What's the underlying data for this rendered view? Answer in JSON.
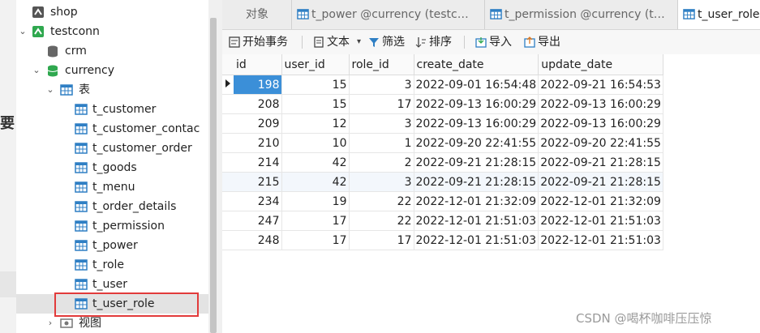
{
  "side_fragment": {
    "glyph": "要"
  },
  "tree": {
    "shop": "shop",
    "testconn": "testconn",
    "crm": "crm",
    "currency": "currency",
    "tables_folder": "表",
    "tables": [
      "t_customer",
      "t_customer_contac",
      "t_customer_order",
      "t_goods",
      "t_menu",
      "t_order_details",
      "t_permission",
      "t_power",
      "t_role",
      "t_user",
      "t_user_role"
    ],
    "views_folder": "视图"
  },
  "tabs": [
    {
      "label": "对象"
    },
    {
      "label": "t_power @currency (testc…"
    },
    {
      "label": "t_permission @currency (t…"
    },
    {
      "label": "t_user_role"
    }
  ],
  "toolbar": {
    "begin_tx": "开始事务",
    "text": "文本",
    "text_caret": "▾",
    "filter": "筛选",
    "sort": "排序",
    "import": "导入",
    "export": "导出"
  },
  "grid": {
    "columns": [
      "id",
      "user_id",
      "role_id",
      "create_date",
      "update_date"
    ],
    "rows": [
      [
        "198",
        "15",
        "3",
        "2022-09-01 16:54:48",
        "2022-09-21 16:54:53"
      ],
      [
        "208",
        "15",
        "17",
        "2022-09-13 16:00:29",
        "2022-09-13 16:00:29"
      ],
      [
        "209",
        "12",
        "3",
        "2022-09-13 16:00:29",
        "2022-09-13 16:00:29"
      ],
      [
        "210",
        "10",
        "1",
        "2022-09-20 22:41:55",
        "2022-09-20 22:41:55"
      ],
      [
        "214",
        "42",
        "2",
        "2022-09-21 21:28:15",
        "2022-09-21 21:28:15"
      ],
      [
        "215",
        "42",
        "3",
        "2022-09-21 21:28:15",
        "2022-09-21 21:28:15"
      ],
      [
        "234",
        "19",
        "22",
        "2022-12-01 21:32:09",
        "2022-12-01 21:32:09"
      ],
      [
        "247",
        "17",
        "22",
        "2022-12-01 21:51:03",
        "2022-12-01 21:51:03"
      ],
      [
        "248",
        "17",
        "17",
        "2022-12-01 21:51:03",
        "2022-12-01 21:51:03"
      ]
    ]
  },
  "watermark": "CSDN @喝杯咖啡压压惊",
  "colors": {
    "selected_cell": "#3b8fd8",
    "highlight_box": "#e23b3b",
    "db_green": "#2fa84f",
    "table_blue": "#2f7fc4"
  }
}
